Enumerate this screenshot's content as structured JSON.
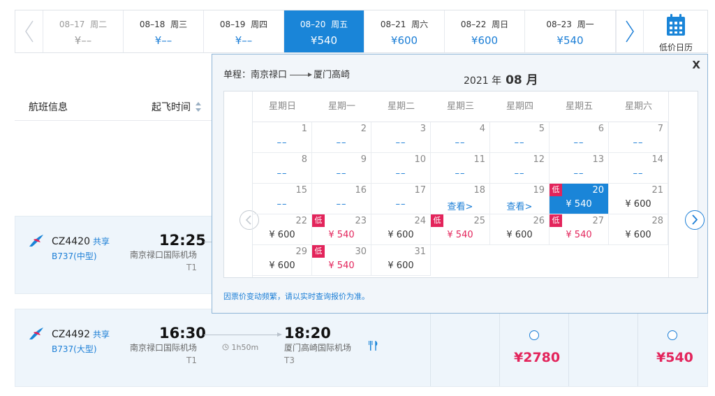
{
  "date_strip": {
    "days": [
      {
        "date": "08–17",
        "weekday": "周二",
        "price": "¥––",
        "state": "muted"
      },
      {
        "date": "08–18",
        "weekday": "周三",
        "price": "¥––",
        "state": "normal"
      },
      {
        "date": "08–19",
        "weekday": "周四",
        "price": "¥––",
        "state": "normal"
      },
      {
        "date": "08–20",
        "weekday": "周五",
        "price": "¥540",
        "state": "active"
      },
      {
        "date": "08–21",
        "weekday": "周六",
        "price": "¥600",
        "state": "normal"
      },
      {
        "date": "08–22",
        "weekday": "周日",
        "price": "¥600",
        "state": "normal"
      },
      {
        "date": "08–23",
        "weekday": "周一",
        "price": "¥540",
        "state": "normal"
      }
    ],
    "calendar_label": "低价日历"
  },
  "list_header": {
    "info_label": "航班信息",
    "sort_label": "起飞时间"
  },
  "flights": [
    {
      "number": "CZ4420",
      "share": "共享",
      "aircraft": "B737(中型)",
      "dep_time": "12:25",
      "dep_airport": "南京禄口国际机场",
      "dep_terminal": "T1"
    },
    {
      "number": "CZ4492",
      "share": "共享",
      "aircraft": "B737(大型)",
      "dep_time": "16:30",
      "dep_airport": "南京禄口国际机场",
      "dep_terminal": "T1",
      "duration": "1h50m",
      "arr_time": "18:20",
      "arr_airport": "厦门高崎国际机场",
      "arr_terminal": "T3",
      "prices": [
        "¥2780",
        "¥540"
      ]
    }
  ],
  "calendar": {
    "route_from": "单程：南京禄口",
    "route_to": "厦门高崎",
    "year_label": "2021 年",
    "month_label": "08 月",
    "close_label": "X",
    "weekdays": [
      "星期日",
      "星期一",
      "星期二",
      "星期三",
      "星期四",
      "星期五",
      "星期六"
    ],
    "days": [
      {
        "day": "1",
        "value": "––",
        "kind": "dash"
      },
      {
        "day": "2",
        "value": "––",
        "kind": "dash"
      },
      {
        "day": "3",
        "value": "––",
        "kind": "dash"
      },
      {
        "day": "4",
        "value": "––",
        "kind": "dash"
      },
      {
        "day": "5",
        "value": "––",
        "kind": "dash"
      },
      {
        "day": "6",
        "value": "––",
        "kind": "dash"
      },
      {
        "day": "7",
        "value": "––",
        "kind": "dash"
      },
      {
        "day": "8",
        "value": "––",
        "kind": "dash"
      },
      {
        "day": "9",
        "value": "––",
        "kind": "dash"
      },
      {
        "day": "10",
        "value": "––",
        "kind": "dash"
      },
      {
        "day": "11",
        "value": "––",
        "kind": "dash"
      },
      {
        "day": "12",
        "value": "––",
        "kind": "dash"
      },
      {
        "day": "13",
        "value": "––",
        "kind": "dash"
      },
      {
        "day": "14",
        "value": "––",
        "kind": "dash"
      },
      {
        "day": "15",
        "value": "––",
        "kind": "dash"
      },
      {
        "day": "16",
        "value": "––",
        "kind": "dash"
      },
      {
        "day": "17",
        "value": "––",
        "kind": "dash"
      },
      {
        "day": "18",
        "value": "查看>",
        "kind": "link"
      },
      {
        "day": "19",
        "value": "查看>",
        "kind": "link"
      },
      {
        "day": "20",
        "value": "¥ 540",
        "kind": "selected",
        "low": "低"
      },
      {
        "day": "21",
        "value": "¥ 600",
        "kind": "normal"
      },
      {
        "day": "22",
        "value": "¥ 600",
        "kind": "normal"
      },
      {
        "day": "23",
        "value": "¥ 540",
        "kind": "red",
        "low": "低"
      },
      {
        "day": "24",
        "value": "¥ 600",
        "kind": "normal"
      },
      {
        "day": "25",
        "value": "¥ 540",
        "kind": "red",
        "low": "低"
      },
      {
        "day": "26",
        "value": "¥ 600",
        "kind": "normal"
      },
      {
        "day": "27",
        "value": "¥ 540",
        "kind": "red",
        "low": "低"
      },
      {
        "day": "28",
        "value": "¥ 600",
        "kind": "normal"
      },
      {
        "day": "29",
        "value": "¥ 600",
        "kind": "normal"
      },
      {
        "day": "30",
        "value": "¥ 540",
        "kind": "red",
        "low": "低"
      },
      {
        "day": "31",
        "value": "¥ 600",
        "kind": "normal"
      }
    ],
    "note": "因票价变动频繁，请以实时查询报价为准。"
  },
  "colors": {
    "accent": "#1a85d8",
    "low_badge": "#e3245b",
    "price_red": "#e3245b"
  }
}
